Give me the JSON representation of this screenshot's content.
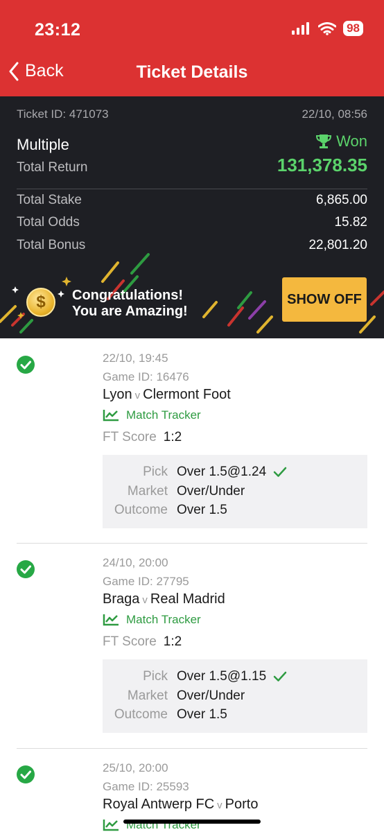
{
  "status": {
    "time": "23:12",
    "battery": "98"
  },
  "nav": {
    "back_label": "Back",
    "title": "Ticket Details"
  },
  "summary": {
    "ticket_id": "Ticket ID: 471073",
    "datetime": "22/10, 08:56",
    "bet_type": "Multiple",
    "status": "Won",
    "total_return_label": "Total Return",
    "total_return": "131,378.35",
    "rows": [
      {
        "label": "Total Stake",
        "value": "6,865.00"
      },
      {
        "label": "Total Odds",
        "value": "15.82"
      },
      {
        "label": "Total Bonus",
        "value": "22,801.20"
      }
    ],
    "banner_line1": "Congratulations!",
    "banner_line2": "You are Amazing!",
    "show_off_label": "SHOW OFF",
    "accent_green": "#5bd36b",
    "button_color": "#f4b83e"
  },
  "matches": [
    {
      "datetime": "22/10, 19:45",
      "game_id": "Game ID: 16476",
      "home": "Lyon",
      "vs": "v",
      "away": "Clermont Foot",
      "tracker_label": "Match Tracker",
      "ft_label": "FT Score",
      "ft_score": "1:2",
      "pick_label": "Pick",
      "pick": "Over 1.5@1.24",
      "market_label": "Market",
      "market": "Over/Under",
      "outcome_label": "Outcome",
      "outcome": "Over 1.5"
    },
    {
      "datetime": "24/10, 20:00",
      "game_id": "Game ID: 27795",
      "home": "Braga",
      "vs": "v",
      "away": "Real Madrid",
      "tracker_label": "Match Tracker",
      "ft_label": "FT Score",
      "ft_score": "1:2",
      "pick_label": "Pick",
      "pick": "Over 1.5@1.15",
      "market_label": "Market",
      "market": "Over/Under",
      "outcome_label": "Outcome",
      "outcome": "Over 1.5"
    },
    {
      "datetime": "25/10, 20:00",
      "game_id": "Game ID: 25593",
      "home": "Royal Antwerp FC",
      "vs": "v",
      "away": "Porto",
      "tracker_label": "Match Tracker"
    }
  ]
}
